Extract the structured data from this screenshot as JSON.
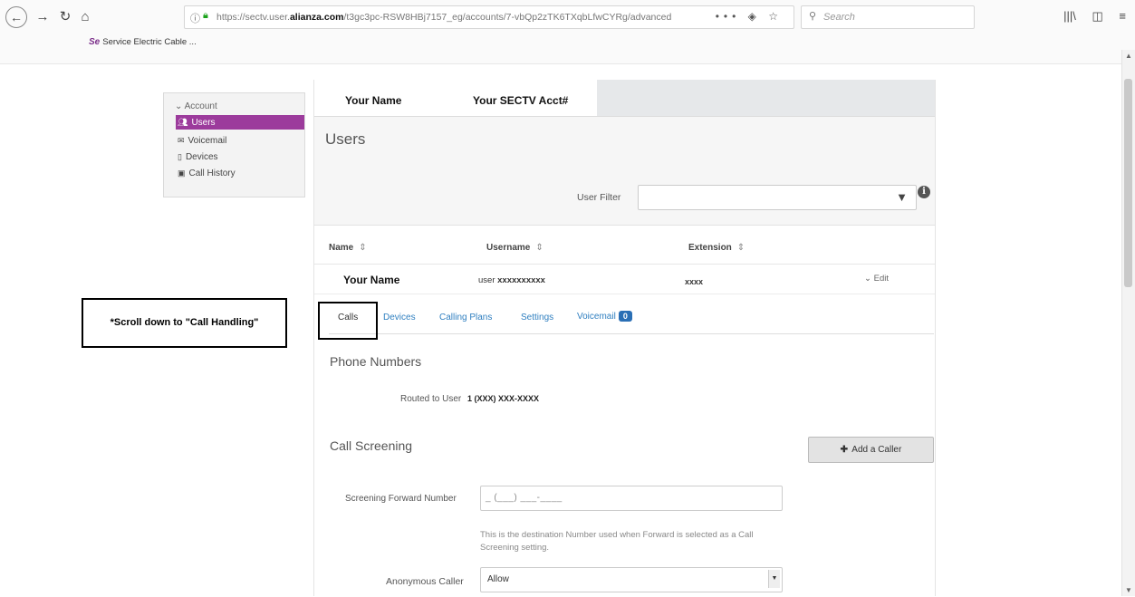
{
  "browser": {
    "url_prefix": "https://sectv.user.",
    "url_domain": "alianza.com",
    "url_rest": "/t3gc3pc-RSW8HBj7157_eg/accounts/7-vbQp2zTK6TXqbLfwCYRg/advanced",
    "search_placeholder": "Search",
    "bookmark_logo": "Se",
    "bookmark_label": "Service Electric Cable ...",
    "icons": [
      "back-icon",
      "forward-icon",
      "reload-icon",
      "home-icon",
      "info-icon",
      "lock-icon",
      "more-icon",
      "pocket-icon",
      "star-icon",
      "search-icon",
      "library-icon",
      "sidebar-icon",
      "menu-icon"
    ]
  },
  "sidebar": {
    "section": "Account",
    "items": [
      {
        "label": "Users",
        "icon": "users-icon",
        "active": true
      },
      {
        "label": "Voicemail",
        "icon": "envelope-icon",
        "active": false
      },
      {
        "label": "Devices",
        "icon": "phone-icon",
        "active": false
      },
      {
        "label": "Call History",
        "icon": "history-icon",
        "active": false
      }
    ]
  },
  "header": {
    "name": "Your Name",
    "account": "Your SECTV Acct#"
  },
  "page": {
    "title": "Users",
    "filter_label": "User Filter",
    "filter_value": ""
  },
  "table": {
    "columns": [
      "Name",
      "Username",
      "Extension"
    ],
    "sort_glyph": "⇕",
    "row": {
      "name": "Your Name",
      "username_prefix": "user",
      "username_value": "xxxxxxxxxx",
      "extension": "xxxx",
      "edit": "Edit"
    }
  },
  "tabs": {
    "items": [
      "Calls",
      "Devices",
      "Calling Plans",
      "Settings",
      "Voicemail"
    ],
    "active": "Calls",
    "voicemail_count": "0"
  },
  "phone_numbers": {
    "title": "Phone Numbers",
    "routed_label": "Routed to User",
    "routed_value": "1 (XXX) XXX-XXXX"
  },
  "call_screening": {
    "title": "Call Screening",
    "add_caller": "Add a Caller",
    "forward_label": "Screening Forward Number",
    "forward_value": "_ (___) ___-____",
    "help": "This is the destination Number used when Forward is selected as a Call Screening setting.",
    "anon_label": "Anonymous Caller",
    "anon_value": "Allow"
  },
  "annotation": {
    "note": "*Scroll down to \"Call Handling\""
  }
}
